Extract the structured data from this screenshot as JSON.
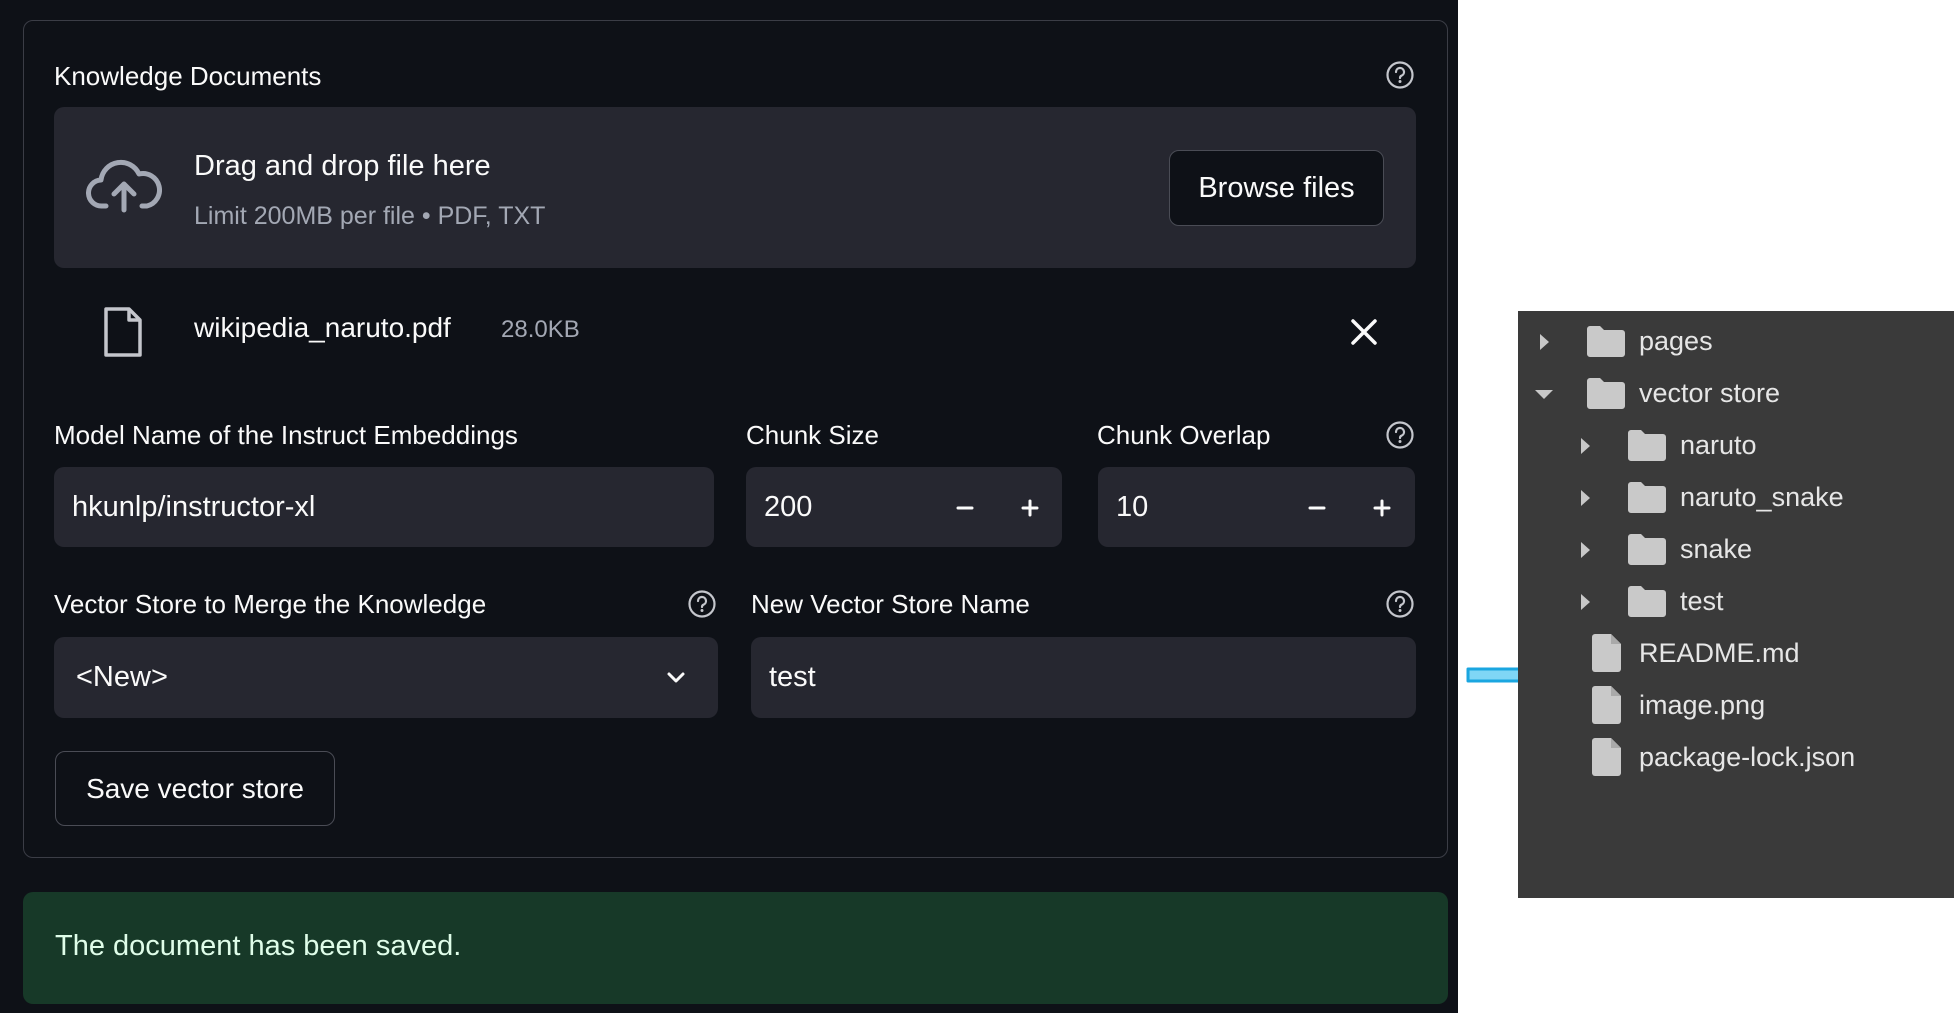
{
  "knowledge_documents": {
    "label": "Knowledge Documents",
    "dropzone": {
      "title": "Drag and drop file here",
      "limits": "Limit 200MB per file • PDF, TXT",
      "browse_label": "Browse files"
    },
    "uploaded_file": {
      "name": "wikipedia_naruto.pdf",
      "size": "28.0KB"
    }
  },
  "model_name": {
    "label": "Model Name of the Instruct Embeddings",
    "value": "hkunlp/instructor-xl"
  },
  "chunk_size": {
    "label": "Chunk Size",
    "value": "200",
    "decrement": "−",
    "increment": "+"
  },
  "chunk_overlap": {
    "label": "Chunk Overlap",
    "value": "10",
    "decrement": "−",
    "increment": "+"
  },
  "merge_store": {
    "label": "Vector Store to Merge the Knowledge",
    "selected": "<New>"
  },
  "new_store_name": {
    "label": "New Vector Store Name",
    "value": "test"
  },
  "save_button": "Save vector store",
  "success_message": "The document has been saved.",
  "explorer": {
    "items": [
      {
        "label": "pages",
        "kind": "folder",
        "expanded": false,
        "depth": 0
      },
      {
        "label": "vector store",
        "kind": "folder",
        "expanded": true,
        "depth": 0
      },
      {
        "label": "naruto",
        "kind": "folder",
        "expanded": false,
        "depth": 1
      },
      {
        "label": "naruto_snake",
        "kind": "folder",
        "expanded": false,
        "depth": 1
      },
      {
        "label": "snake",
        "kind": "folder",
        "expanded": false,
        "depth": 1
      },
      {
        "label": "test",
        "kind": "folder",
        "expanded": false,
        "depth": 1
      },
      {
        "label": "README.md",
        "kind": "file",
        "depth": 0
      },
      {
        "label": "image.png",
        "kind": "file",
        "depth": 0
      },
      {
        "label": "package-lock.json",
        "kind": "file",
        "depth": 0
      }
    ]
  },
  "colors": {
    "app_bg": "#0e1117",
    "input_bg": "#262730",
    "success_bg": "#173928",
    "explorer_bg": "#3a3a3a",
    "arrow": "#29b6e8"
  }
}
